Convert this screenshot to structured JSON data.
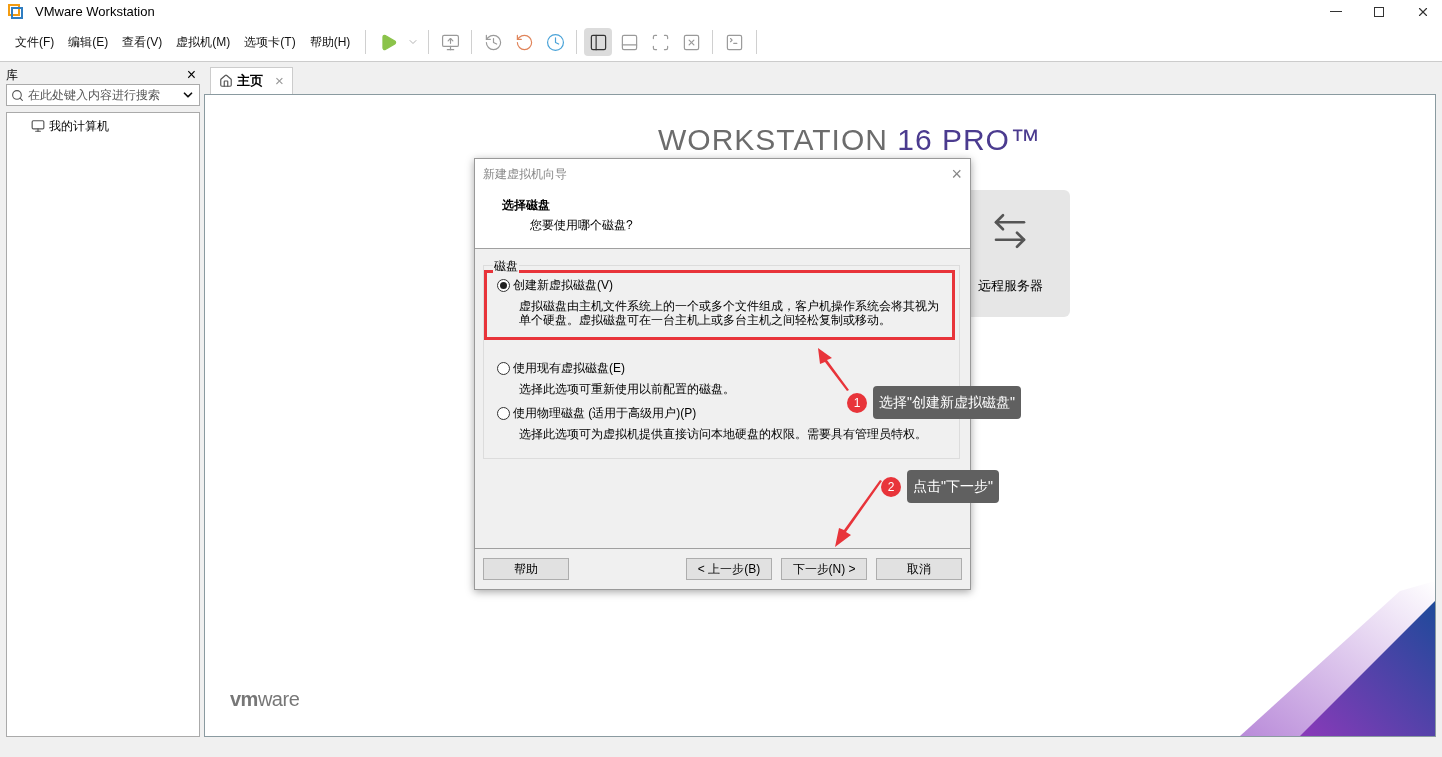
{
  "window": {
    "title": "VMware Workstation"
  },
  "menu": [
    "文件(F)",
    "编辑(E)",
    "查看(V)",
    "虚拟机(M)",
    "选项卡(T)",
    "帮助(H)"
  ],
  "toolbar": [
    {
      "kind": "play",
      "selected": false
    },
    {
      "kind": "caret",
      "selected": false
    },
    {
      "kind": "send",
      "selected": false
    },
    {
      "kind": "snapshot",
      "selected": false
    },
    {
      "kind": "revert",
      "selected": false
    },
    {
      "kind": "manager",
      "selected": false
    },
    {
      "kind": "sidebar",
      "selected": true
    },
    {
      "kind": "bottom",
      "selected": false
    },
    {
      "kind": "fullscreen",
      "selected": false
    },
    {
      "kind": "unity",
      "selected": false
    },
    {
      "kind": "console",
      "selected": false
    }
  ],
  "library": {
    "title": "库",
    "close": "×",
    "search": {
      "placeholder": "在此处键入内容进行搜索"
    },
    "items": [
      {
        "label": "我的计算机",
        "selected": false
      }
    ]
  },
  "tabs": [
    {
      "label": "主页",
      "selected": true,
      "close": "×"
    }
  ],
  "home": {
    "brand": "WORKSTATION",
    "version": "16 PRO™",
    "card": "远程服务器",
    "logo_bold": "vm",
    "logo_rest": "ware"
  },
  "dialog": {
    "title": "新建虚拟机向导",
    "close": "×",
    "heading": "选择磁盘",
    "subheading": "您要使用哪个磁盘?",
    "group": "磁盘",
    "options": [
      {
        "label": "创建新虚拟磁盘(V)",
        "description": "虚拟磁盘由主机文件系统上的一个或多个文件组成，客户机操作系统会将其视为单个硬盘。虚拟磁盘可在一台主机上或多台主机之间轻松复制或移动。",
        "selected": true,
        "highlighted": true
      },
      {
        "label": "使用现有虚拟磁盘(E)",
        "description": "选择此选项可重新使用以前配置的磁盘。",
        "selected": false,
        "highlighted": false
      },
      {
        "label": "使用物理磁盘 (适用于高级用户)(P)",
        "description": "选择此选项可为虚拟机提供直接访问本地硬盘的权限。需要具有管理员特权。",
        "selected": false,
        "highlighted": false
      }
    ],
    "buttons": {
      "help": "帮助",
      "back": "< 上一步(B)",
      "next": "下一步(N) >",
      "cancel": "取消"
    }
  },
  "annotations": [
    {
      "number": "1",
      "text": "选择\"创建新虚拟磁盘\""
    },
    {
      "number": "2",
      "text": "点击\"下一步\""
    }
  ]
}
